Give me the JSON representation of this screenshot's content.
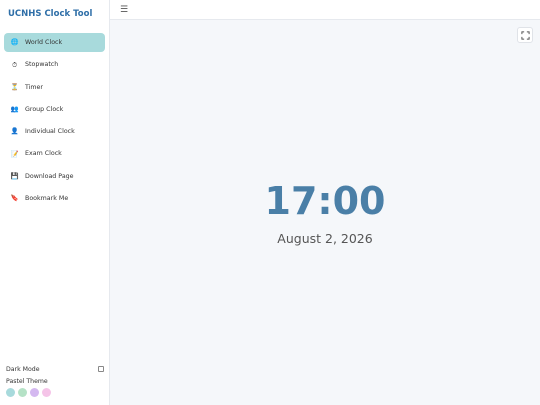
{
  "app": {
    "title": "UCNHS Clock Tool"
  },
  "sidebar": {
    "items": [
      {
        "label": "World Clock",
        "icon": "globe-icon",
        "glyph": "🌐",
        "active": true
      },
      {
        "label": "Stopwatch",
        "icon": "stopwatch-icon",
        "glyph": "⏱",
        "active": false
      },
      {
        "label": "Timer",
        "icon": "hourglass-icon",
        "glyph": "⏳",
        "active": false
      },
      {
        "label": "Group Clock",
        "icon": "group-icon",
        "glyph": "👥",
        "active": false
      },
      {
        "label": "Individual Clock",
        "icon": "user-icon",
        "glyph": "👤",
        "active": false
      },
      {
        "label": "Exam Clock",
        "icon": "memo-icon",
        "glyph": "📝",
        "active": false
      },
      {
        "label": "Download Page",
        "icon": "floppy-disk-icon",
        "glyph": "💾",
        "active": false
      },
      {
        "label": "Bookmark Me",
        "icon": "bookmark-icon",
        "glyph": "🔖",
        "active": false
      }
    ],
    "dark_mode_label": "Dark Mode",
    "dark_mode_checked": false,
    "theme_label": "Pastel Theme",
    "theme_swatches": [
      "#a8dadc",
      "#b5e2c6",
      "#d4b8f0",
      "#f5c4e8"
    ]
  },
  "topbar": {
    "menu_icon": "hamburger-menu-icon"
  },
  "main": {
    "fullscreen_icon": "fullscreen-icon",
    "time": "17:00",
    "date": "August 2, 2026"
  },
  "colors": {
    "accent": "#2f6fa8",
    "clock": "#4a7fa7",
    "active_item_bg": "#a8dadc",
    "background": "#f5f7fa"
  }
}
